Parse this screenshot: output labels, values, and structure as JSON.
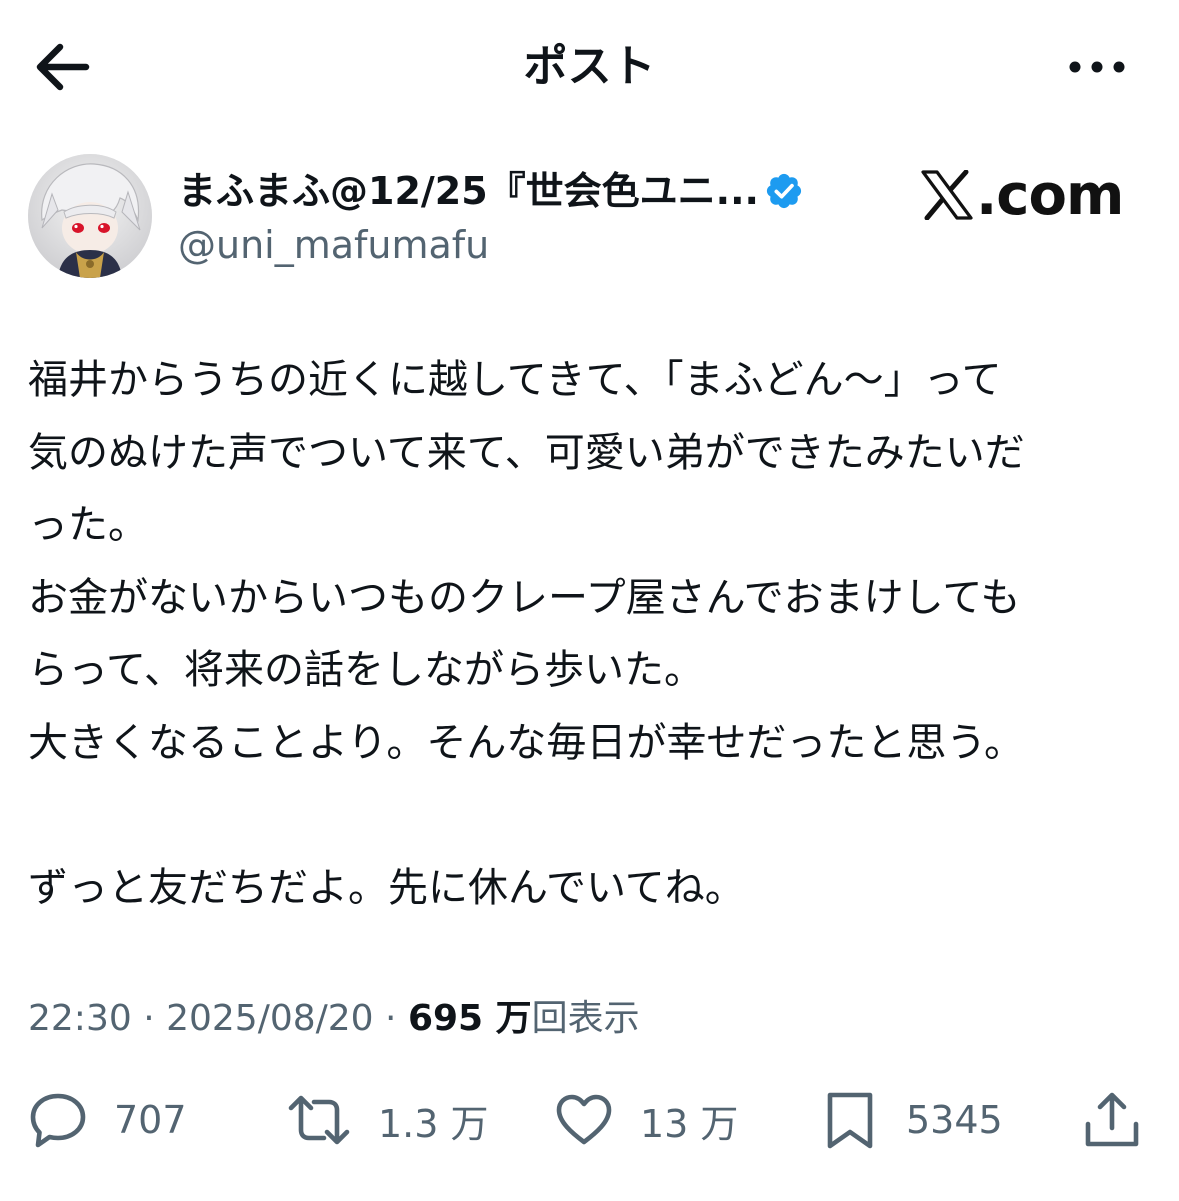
{
  "header": {
    "title": "ポスト",
    "back_icon": "arrow-left-icon",
    "more_icon": "more-horizontal-icon"
  },
  "author": {
    "display_name": "まふまふ@12/25『世会色ユニ...",
    "handle": "@uni_mafumafu",
    "verified": true,
    "verified_color": "#1d9bf0"
  },
  "watermark": {
    "text": ".com",
    "icon": "x-logo-icon"
  },
  "post": {
    "lines": [
      "福井からうちの近くに越してきて、「まふどん〜」って",
      "気のぬけた声でついて来て、可愛い弟ができたみたいだ",
      "った。",
      "お金がないからいつものクレープ屋さんでおまけしても",
      "らって、将来の話をしながら歩いた。",
      "大きくなることより。そんな毎日が幸せだったと思う。",
      "",
      "ずっと友だちだよ。先に休んでいてね。"
    ]
  },
  "meta": {
    "time": "22:30",
    "separator": " · ",
    "date": "2025/08/20",
    "views_count": "695 万",
    "views_label": "回表示"
  },
  "actions": {
    "reply": {
      "icon": "reply-icon",
      "count": "707"
    },
    "repost": {
      "icon": "repost-icon",
      "count": "1.3 万"
    },
    "like": {
      "icon": "heart-icon",
      "count": "13 万"
    },
    "bookmark": {
      "icon": "bookmark-icon",
      "count": "5345"
    },
    "share": {
      "icon": "share-icon"
    }
  },
  "colors": {
    "text_primary": "#0f1419",
    "text_secondary": "#536471",
    "accent": "#1d9bf0"
  }
}
